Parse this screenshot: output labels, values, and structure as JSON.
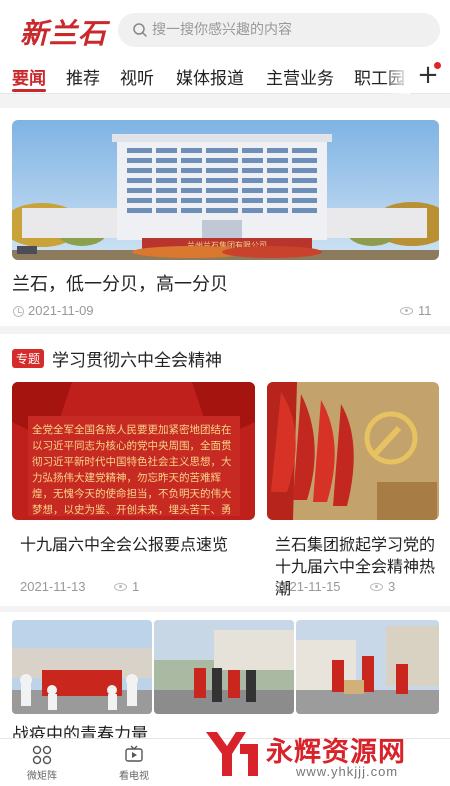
{
  "header": {
    "logo_text": "新兰石",
    "search_placeholder": "搜一搜你感兴趣的内容"
  },
  "tabs": [
    {
      "label": "要闻",
      "active": true
    },
    {
      "label": "推荐"
    },
    {
      "label": "视听"
    },
    {
      "label": "媒体报道"
    },
    {
      "label": "主营业务"
    },
    {
      "label": "职工园地"
    }
  ],
  "tabs_more_icon": "plus-icon",
  "feature": {
    "title": "兰石，低一分贝，高一分贝",
    "date": "2021-11-09",
    "views": "11",
    "sign_text": "兰州兰石集团有限公司"
  },
  "topic": {
    "badge": "专题",
    "title": "学习贯彻六中全会精神",
    "items": [
      {
        "title": "十九届六中全会公报要点速览",
        "date": "2021-11-13",
        "views": "1",
        "banner_text": "全党全军全国各族人民要更加紧密地团结在以习近平同志为核心的党中央周围，全面贯彻习近平新时代中国特色社会主义思想，大力弘扬伟大建党精神，勿忘昨天的苦难辉煌，无愧今天的使命担当，不负明天的伟大梦想，以史为鉴、开创未来，埋头苦干、勇"
      },
      {
        "title": "兰石集团掀起学习党的十九届六中全会精神热潮",
        "date": "2021-11-15",
        "views": "3"
      }
    ]
  },
  "gallery": {
    "title": "战疫中的青春力量"
  },
  "bottom_nav": [
    {
      "label": "微矩阵",
      "icon": "grid-icon"
    },
    {
      "label": "看电视",
      "icon": "tv-icon"
    }
  ],
  "watermark": {
    "brand": "永辉资源网",
    "url": "www.yhkjjj.com"
  },
  "colors": {
    "accent": "#c9282d",
    "badge": "#d62b2b"
  }
}
